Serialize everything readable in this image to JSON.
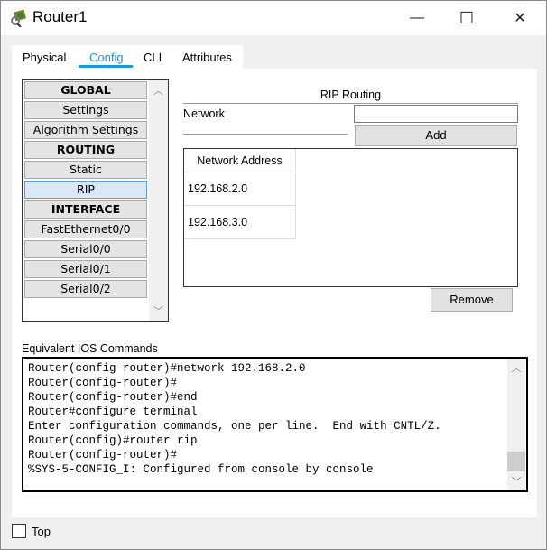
{
  "window": {
    "title": "Router1",
    "icon": "router-icon",
    "minimize": "—",
    "maximize": "☐",
    "close": "✕"
  },
  "tabs": [
    {
      "label": "Physical"
    },
    {
      "label": "Config",
      "active": true
    },
    {
      "label": "CLI"
    },
    {
      "label": "Attributes"
    }
  ],
  "accent": "#1a9ad6",
  "sidebar": {
    "items": [
      {
        "label": "GLOBAL",
        "header": true
      },
      {
        "label": "Settings"
      },
      {
        "label": "Algorithm Settings"
      },
      {
        "label": "ROUTING",
        "header": true
      },
      {
        "label": "Static"
      },
      {
        "label": "RIP",
        "selected": true
      },
      {
        "label": "INTERFACE",
        "header": true
      },
      {
        "label": "FastEthernet0/0"
      },
      {
        "label": "Serial0/0"
      },
      {
        "label": "Serial0/1"
      },
      {
        "label": "Serial0/2"
      }
    ]
  },
  "rip": {
    "title": "RIP Routing",
    "network_label": "Network",
    "network_value": "",
    "add_label": "Add",
    "table_header": "Network Address",
    "rows": [
      "192.168.2.0",
      "192.168.3.0"
    ],
    "remove_label": "Remove"
  },
  "console": {
    "label": "Equivalent IOS Commands",
    "lines": [
      "Router(config-router)#network 192.168.2.0",
      "Router(config-router)#",
      "Router(config-router)#end",
      "Router#configure terminal",
      "Enter configuration commands, one per line.  End with CNTL/Z.",
      "Router(config)#router rip",
      "Router(config-router)#",
      "%SYS-5-CONFIG_I: Configured from console by console"
    ]
  },
  "footer": {
    "top_label": "Top",
    "top_checked": false
  }
}
